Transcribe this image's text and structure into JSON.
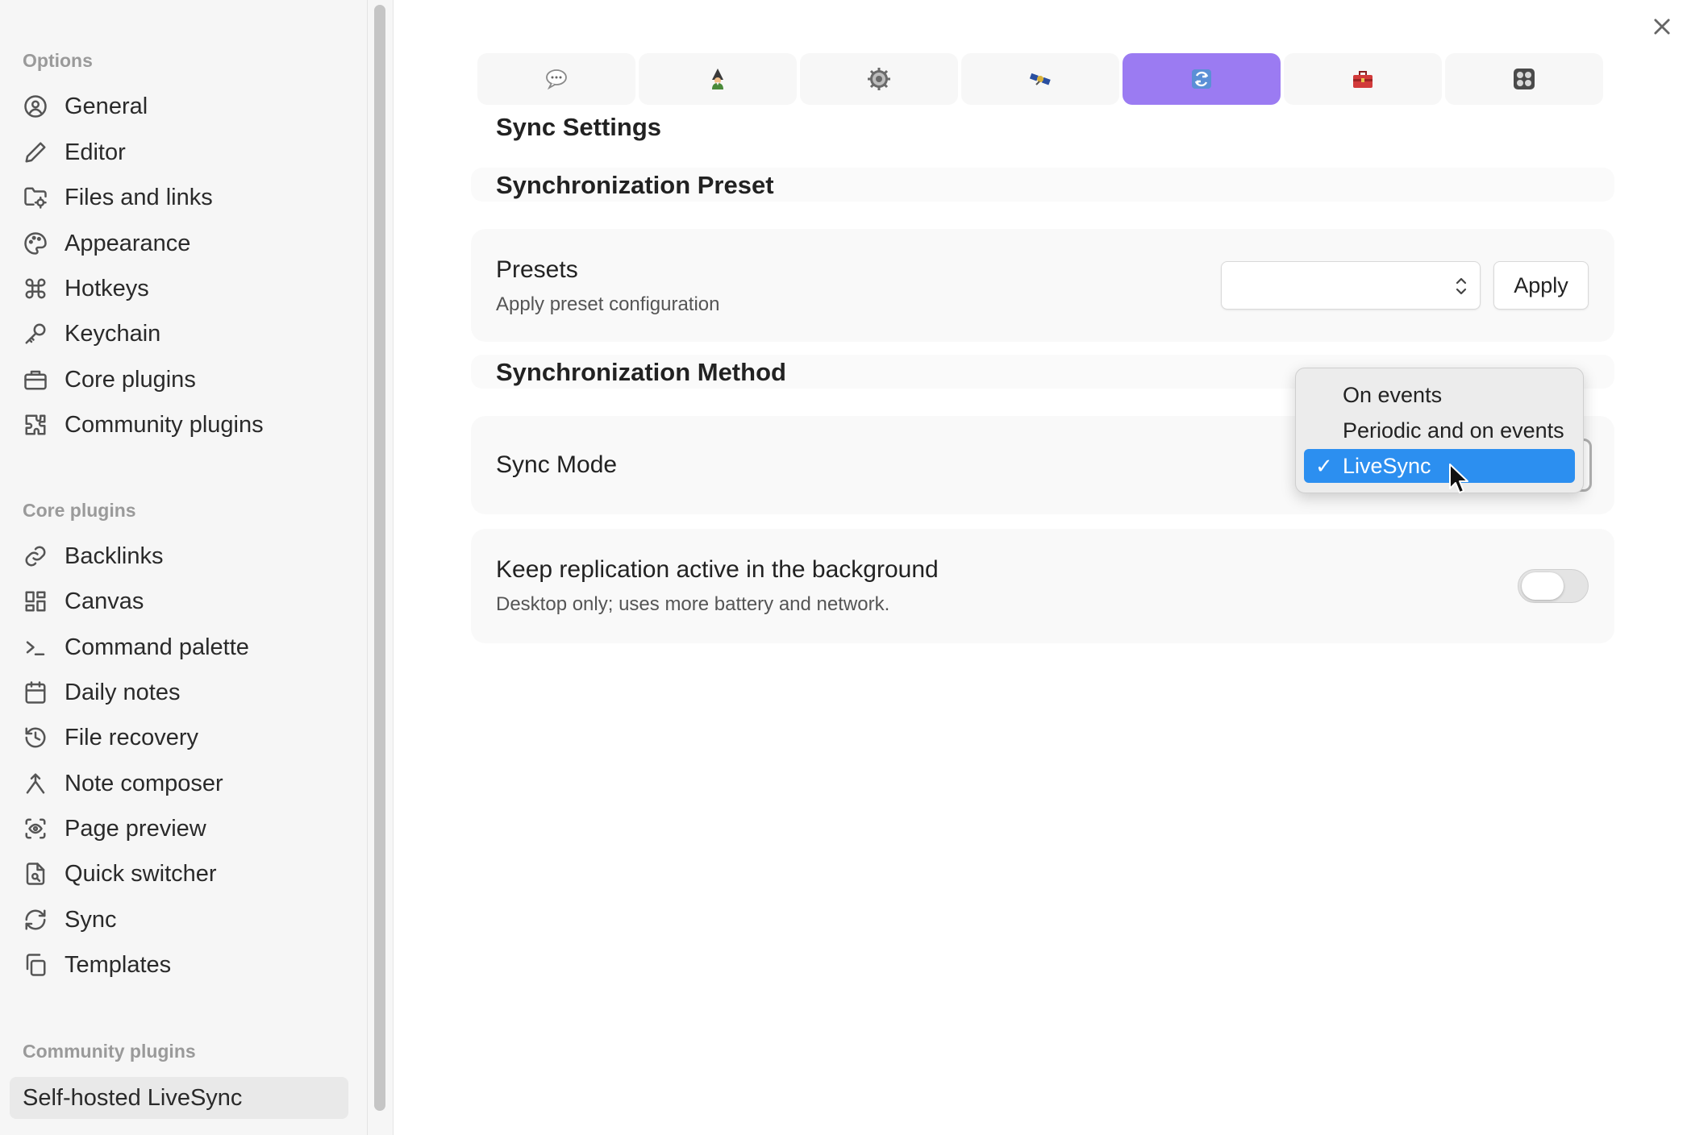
{
  "sidebar": {
    "options_heading": "Options",
    "options": [
      {
        "label": "General",
        "icon": "user-circle-icon"
      },
      {
        "label": "Editor",
        "icon": "pencil-icon"
      },
      {
        "label": "Files and links",
        "icon": "folder-cog-icon"
      },
      {
        "label": "Appearance",
        "icon": "palette-icon"
      },
      {
        "label": "Hotkeys",
        "icon": "command-icon"
      },
      {
        "label": "Keychain",
        "icon": "key-icon"
      },
      {
        "label": "Core plugins",
        "icon": "briefcase-icon"
      },
      {
        "label": "Community plugins",
        "icon": "puzzle-icon"
      }
    ],
    "core_heading": "Core plugins",
    "core": [
      {
        "label": "Backlinks",
        "icon": "link-icon"
      },
      {
        "label": "Canvas",
        "icon": "layout-grid-icon"
      },
      {
        "label": "Command palette",
        "icon": "terminal-icon"
      },
      {
        "label": "Daily notes",
        "icon": "calendar-icon"
      },
      {
        "label": "File recovery",
        "icon": "history-icon"
      },
      {
        "label": "Note composer",
        "icon": "merge-icon"
      },
      {
        "label": "Page preview",
        "icon": "eye-scan-icon"
      },
      {
        "label": "Quick switcher",
        "icon": "file-search-icon"
      },
      {
        "label": "Sync",
        "icon": "refresh-icon"
      },
      {
        "label": "Templates",
        "icon": "copy-icon"
      }
    ],
    "community_heading": "Community plugins",
    "community": [
      {
        "label": "Self-hosted LiveSync",
        "active": true
      }
    ]
  },
  "tabs": [
    {
      "icon": "speech-bubble-icon",
      "active": false
    },
    {
      "icon": "wizard-icon",
      "active": false
    },
    {
      "icon": "gear-icon",
      "active": false
    },
    {
      "icon": "satellite-icon",
      "active": false
    },
    {
      "icon": "sync-arrows-icon",
      "active": true
    },
    {
      "icon": "toolbox-icon",
      "active": false
    },
    {
      "icon": "control-knobs-icon",
      "active": false
    }
  ],
  "main": {
    "page_title": "Sync Settings",
    "preset_section": "Synchronization Preset",
    "presets_name": "Presets",
    "presets_desc": "Apply preset configuration",
    "presets_value": "",
    "apply_label": "Apply",
    "method_section": "Synchronization Method",
    "sync_mode_name": "Sync Mode",
    "sync_mode_options": [
      "On events",
      "Periodic and on events",
      "LiveSync"
    ],
    "sync_mode_selected": "LiveSync",
    "check_mark": "✓",
    "bg_name": "Keep replication active in the background",
    "bg_desc": "Desktop only; uses more battery and network.",
    "bg_enabled": false
  },
  "colors": {
    "accent": "#9b7bf2",
    "selection": "#2c8ff0"
  }
}
